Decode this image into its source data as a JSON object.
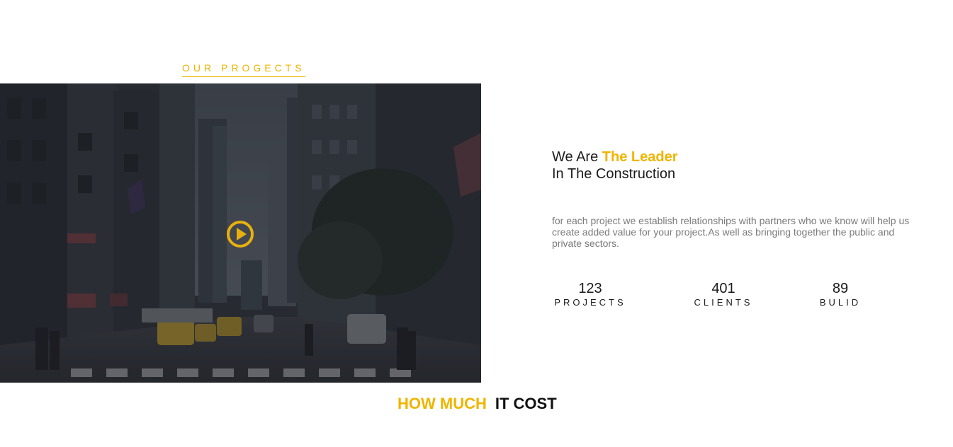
{
  "projects_section": {
    "label": "OUR PROGECTS"
  },
  "video": {
    "play_icon": "play-circle-icon",
    "accent_color": "#f0b400"
  },
  "about": {
    "headline_prefix": "We Are",
    "headline_accent": "The Leader",
    "headline_line2": "In The Construction",
    "description": "for each project we establish relationships with partners who we know will help us create added value for your project.As well as bringing together the public and private sectors."
  },
  "stats": [
    {
      "value": "123",
      "label": "PROJECTS"
    },
    {
      "value": "401",
      "label": "CLIENTS"
    },
    {
      "value": "89",
      "label": "BULID"
    }
  ],
  "pricing": {
    "heading_accent": "HOW MUCH",
    "heading_rest": "IT COST"
  },
  "colors": {
    "accent": "#f0b400",
    "text": "#1b1b1b",
    "muted": "#7a7a7a"
  }
}
